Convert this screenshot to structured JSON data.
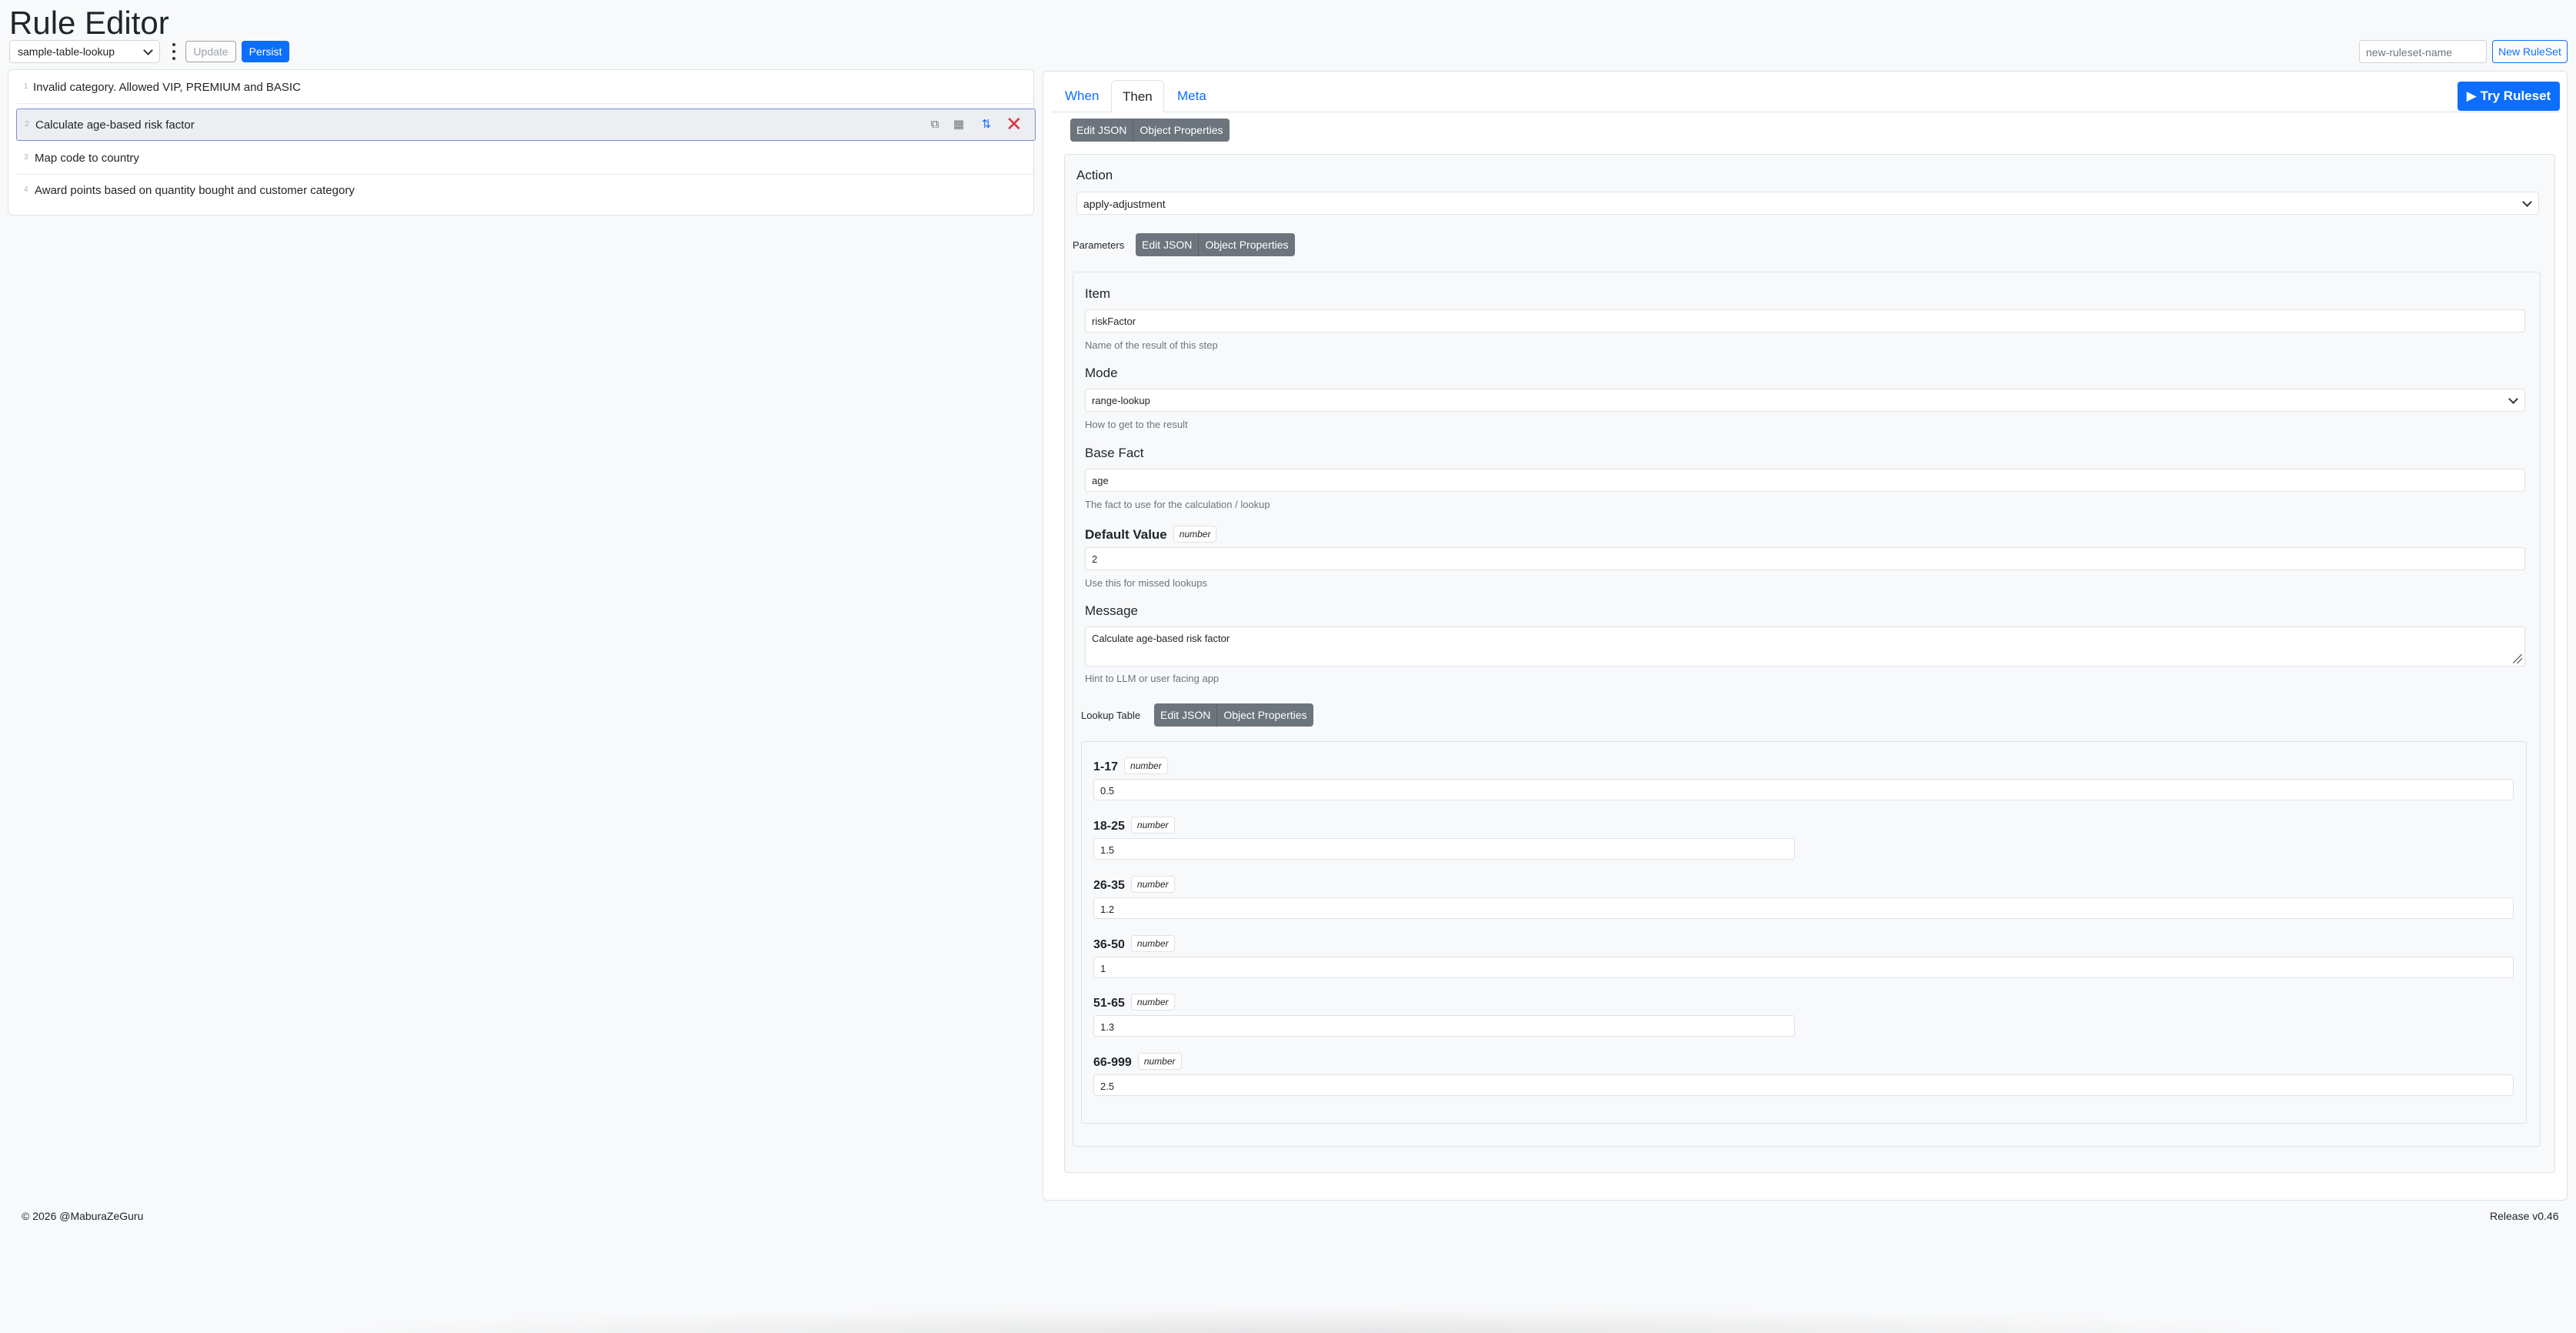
{
  "header": {
    "title": "Rule Editor",
    "ruleset_selected": "sample-table-lookup",
    "update_label": "Update",
    "persist_label": "Persist",
    "ruleset_name_placeholder": "new-ruleset-name",
    "new_ruleset_label": "New RuleSet"
  },
  "rules": [
    {
      "num": "1",
      "label": "Invalid category. Allowed VIP, PREMIUM and BASIC"
    },
    {
      "num": "2",
      "label": "Calculate age-based risk factor"
    },
    {
      "num": "3",
      "label": "Map code to country"
    },
    {
      "num": "4",
      "label": "Award points based on quantity bought and customer category"
    }
  ],
  "rule_actions": [
    "copy-icon",
    "calculator-icon",
    "move-icon",
    "delete-icon"
  ],
  "tabs": [
    "When",
    "Then",
    "Meta"
  ],
  "active_tab": "Then",
  "try_label": "▶ Try Ruleset",
  "toggle": {
    "edit_json": "Edit JSON",
    "object_properties": "Object Properties"
  },
  "action": {
    "label": "Action",
    "value": "apply-adjustment"
  },
  "parameters": {
    "label": "Parameters",
    "item": {
      "label": "Item",
      "value": "riskFactor",
      "help": "Name of the result of this step"
    },
    "mode": {
      "label": "Mode",
      "value": "range-lookup",
      "help": "How to get to the result"
    },
    "base_fact": {
      "label": "Base Fact",
      "value": "age",
      "help": "The fact to use for the calculation / lookup"
    },
    "default_value": {
      "label": "Default Value",
      "type": "number",
      "value": "2",
      "help": "Use this for missed lookups"
    },
    "message": {
      "label": "Message",
      "value": "Calculate age-based risk factor",
      "help": "Hint to LLM or user facing app"
    }
  },
  "lookup_table": {
    "label": "Lookup Table",
    "entries": [
      {
        "key": "1-17",
        "type": "number",
        "value": "0.5"
      },
      {
        "key": "18-25",
        "type": "number",
        "value": "1.5"
      },
      {
        "key": "26-35",
        "type": "number",
        "value": "1.2"
      },
      {
        "key": "36-50",
        "type": "number",
        "value": "1"
      },
      {
        "key": "51-65",
        "type": "number",
        "value": "1.3"
      },
      {
        "key": "66-999",
        "type": "number",
        "value": "2.5"
      }
    ]
  },
  "footer": {
    "copyright": "© 2026 @MaburaZeGuru",
    "release": "Release v0.46"
  },
  "colors": {
    "primary": "#0d6efd",
    "secondary": "#6c757d",
    "danger": "#dc3545"
  }
}
